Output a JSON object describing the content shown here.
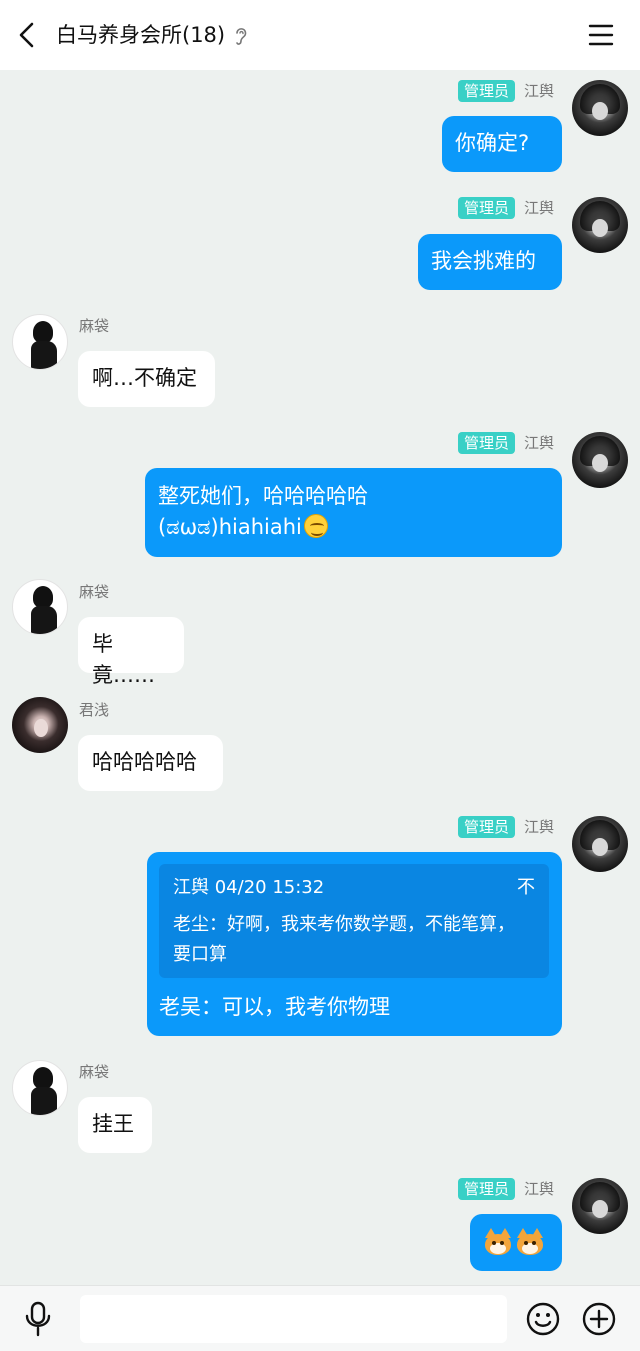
{
  "header": {
    "title": "白马养身会所(18)",
    "icons": {
      "back": "back-icon",
      "listen": "ear-icon",
      "menu": "menu-icon"
    }
  },
  "colors": {
    "outgoing_bubble": "#0b99fa",
    "admin_badge": "#39d0c6",
    "background": "#edf1ef"
  },
  "messages": [
    {
      "direction": "out",
      "sender": "江舆",
      "badge": "管理员",
      "text": "你确定?"
    },
    {
      "direction": "out",
      "sender": "江舆",
      "badge": "管理员",
      "text": "我会挑难的"
    },
    {
      "direction": "in",
      "sender": "麻袋",
      "text": "啊…不确定"
    },
    {
      "direction": "out",
      "sender": "江舆",
      "badge": "管理员",
      "text_line1": "整死她们，哈哈哈哈哈",
      "text_line2": "(ಡωಡ)hiahiahi",
      "emoji": "smirk-emoji"
    },
    {
      "direction": "in",
      "sender": "麻袋",
      "text": "毕竟……"
    },
    {
      "direction": "in",
      "sender": "君浅",
      "text": "哈哈哈哈哈"
    },
    {
      "direction": "out",
      "sender": "江舆",
      "badge": "管理员",
      "quote": {
        "header": "江舆 04/20 15:32",
        "fold": "不",
        "body": "老尘：好啊，我来考你数学题，不能笔算，要口算"
      },
      "text": "老吴：可以，我考你物理"
    },
    {
      "direction": "in",
      "sender": "麻袋",
      "text": "挂王"
    },
    {
      "direction": "out",
      "sender": "江舆",
      "badge": "管理员",
      "stickers": [
        "shiba-emoji",
        "shiba-emoji"
      ]
    }
  ],
  "composer": {
    "placeholder": "",
    "icons": {
      "voice": "mic-icon",
      "emoji": "smile-icon",
      "more": "plus-icon"
    }
  }
}
